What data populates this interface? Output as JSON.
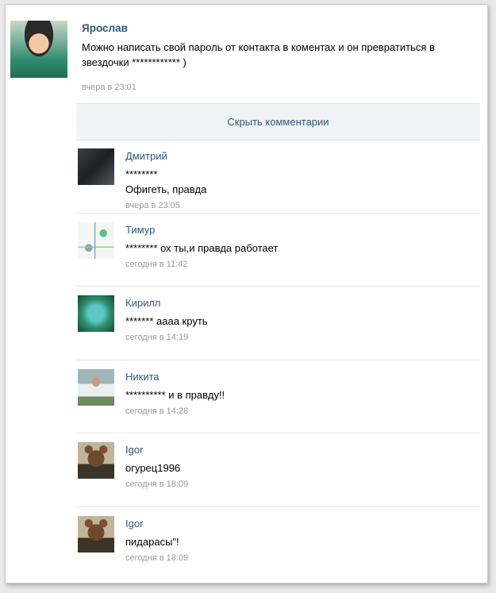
{
  "post": {
    "author": "Ярослав",
    "text": "Можно написать свой пароль от контакта в коментах и он превратиться в звездочки ************ )",
    "time": "вчера в 23:01"
  },
  "hide_comments_label": "Скрыть комментарии",
  "comments": [
    {
      "author": "Дмитрий",
      "text": "********\nОфигеть, правда",
      "time": "вчера в 23:05",
      "avatar": "dark-photo"
    },
    {
      "author": "Тимур",
      "text": "******** ох ты,и правда работает",
      "time": "сегодня в 11:42",
      "avatar": "sketch-photo"
    },
    {
      "author": "Кирилл",
      "text": "******* аааа круть",
      "time": "сегодня в 14:19",
      "avatar": "logo-photo"
    },
    {
      "author": "Никита",
      "text": "********** и в правду!!",
      "time": "сегодня в 14:28",
      "avatar": "person-photo"
    },
    {
      "author": "Igor",
      "text": "огурец1996",
      "time": "сегодня в 18:09",
      "avatar": "dog-photo"
    },
    {
      "author": "Igor",
      "text": "пидарасы\"!",
      "time": "сегодня в 18:09",
      "avatar": "dog-photo"
    }
  ]
}
